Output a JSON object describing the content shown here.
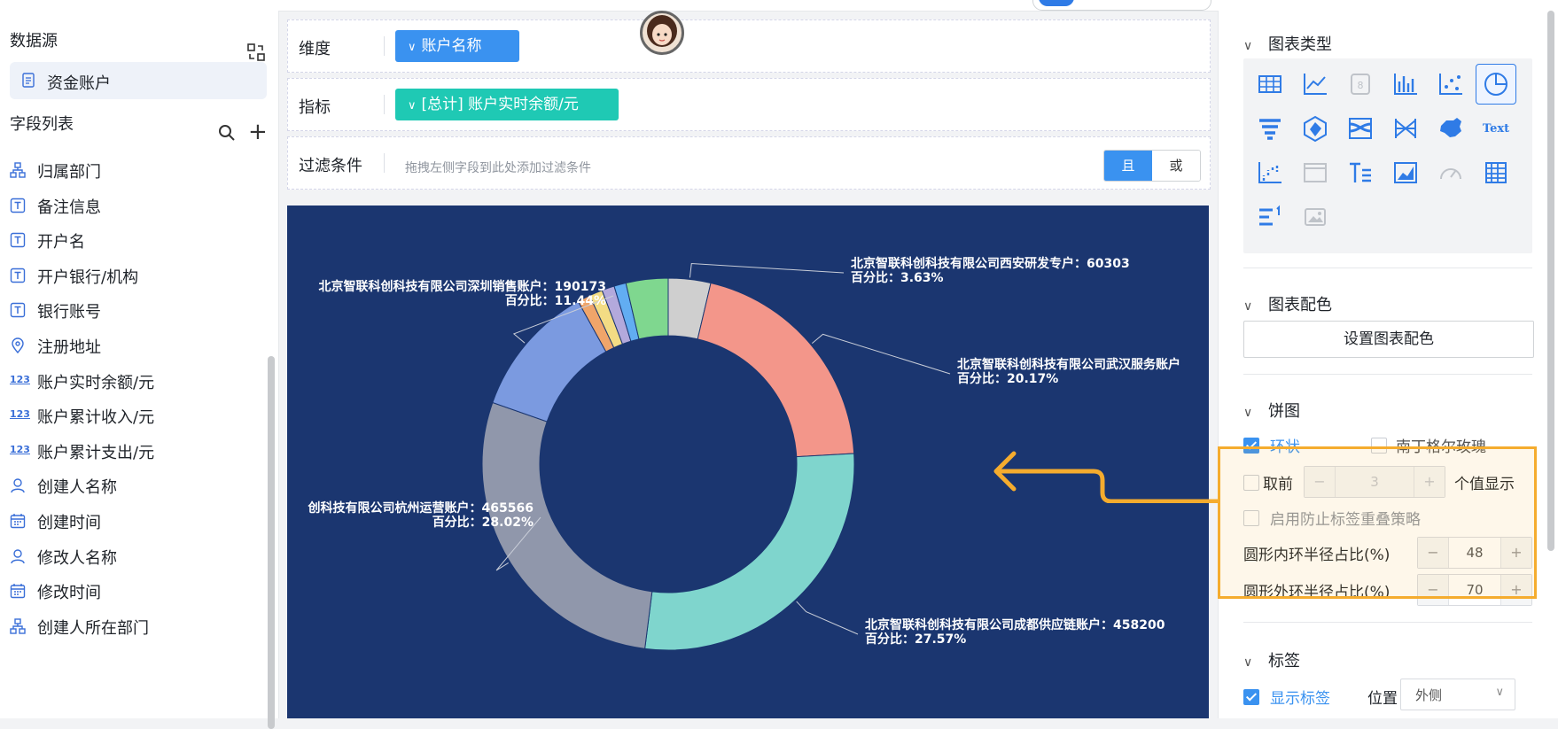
{
  "datasource": {
    "title": "数据源",
    "item": "资金账户"
  },
  "fields": {
    "title": "字段列表",
    "items": [
      {
        "label": "归属部门",
        "icon": "org-icon"
      },
      {
        "label": "备注信息",
        "icon": "text-icon"
      },
      {
        "label": "开户名",
        "icon": "text-icon"
      },
      {
        "label": "开户银行/机构",
        "icon": "text-icon"
      },
      {
        "label": "银行账号",
        "icon": "text-icon"
      },
      {
        "label": "注册地址",
        "icon": "location-icon"
      },
      {
        "label": "账户实时余额/元",
        "icon": "number-icon"
      },
      {
        "label": "账户累计收入/元",
        "icon": "number-icon"
      },
      {
        "label": "账户累计支出/元",
        "icon": "number-icon"
      },
      {
        "label": "创建人名称",
        "icon": "user-icon"
      },
      {
        "label": "创建时间",
        "icon": "calendar-icon"
      },
      {
        "label": "修改人名称",
        "icon": "user-icon"
      },
      {
        "label": "修改时间",
        "icon": "calendar-icon"
      },
      {
        "label": "创建人所在部门",
        "icon": "org-icon"
      }
    ],
    "number_icon_text": "123"
  },
  "query": {
    "dimension_label": "维度",
    "dimension_value": "账户名称",
    "metric_label": "指标",
    "metric_value": "[总计] 账户实时余额/元",
    "filter_label": "过滤条件",
    "filter_hint": "拖拽左侧字段到此处添加过滤条件",
    "and_label": "且",
    "or_label": "或"
  },
  "colors": {
    "chart_bg": "#1b3670",
    "primary": "#3a92f0",
    "metric_pill": "#1fc9b4",
    "highlight": "#f5ac2e"
  },
  "chart_data": {
    "type": "pie",
    "donut": true,
    "inner_radius_pct": 48,
    "outer_radius_pct": 70,
    "slices": [
      {
        "name": "北京智联科创科技有限公司西安研发专户",
        "value": 60303,
        "percent": "3.63%",
        "color": "#cfcfcf"
      },
      {
        "name": "北京智联科创科技有限公司武汉服务账户",
        "value": 335000,
        "percent": "20.17%",
        "color": "#f3968a"
      },
      {
        "name": "北京智联科创科技有限公司成都供应链账户",
        "value": 458200,
        "percent": "27.57%",
        "color": "#7fd5cd"
      },
      {
        "name": "北京智联科创科技有限公司杭州运营账户",
        "value": 465566,
        "percent": "28.02%",
        "color": "#9097ab"
      },
      {
        "name": "北京智联科创科技有限公司深圳销售账户",
        "value": 190173,
        "percent": "11.44%",
        "color": "#7b9ae0"
      },
      {
        "name": "",
        "value": 18000,
        "color": "#f0a56a"
      },
      {
        "name": "",
        "value": 19000,
        "color": "#f3dc84"
      },
      {
        "name": "",
        "value": 18000,
        "color": "#b3a9dc"
      },
      {
        "name": "",
        "value": 17000,
        "color": "#62adf2"
      },
      {
        "name": "",
        "value": 60000,
        "color": "#7fd78f"
      }
    ],
    "labels": [
      {
        "line1": "北京智联科创科技有限公司西安研发专户：60303",
        "line2": "百分比：3.63%"
      },
      {
        "line1": "北京智联科创科技有限公司武汉服务账户",
        "line2": "百分比：20.17%"
      },
      {
        "line1": "北京智联科创科技有限公司成都供应链账户：458200",
        "line2": "百分比：27.57%"
      },
      {
        "line1": "创科技有限公司杭州运营账户：465566",
        "line2": "百分比：28.02%"
      },
      {
        "line1": "北京智联科创科技有限公司深圳销售账户：190173",
        "line2": "百分比：11.44%"
      }
    ]
  },
  "settings": {
    "chart_type_title": "图表类型",
    "chart_color_title": "图表配色",
    "set_color_button": "设置图表配色",
    "pie_title": "饼图",
    "ring_label": "环状",
    "rose_label": "南丁格尔玫瑰",
    "top_label": "取前",
    "top_value": "3",
    "top_suffix": "个值显示",
    "anti_overlap_label": "启用防止标签重叠策略",
    "inner_radius_label": "圆形内环半径占比(%)",
    "inner_radius_value": "48",
    "outer_radius_label": "圆形外环半径占比(%)",
    "outer_radius_value": "70",
    "tag_title": "标签",
    "show_label": "显示标签",
    "position_label": "位置",
    "position_value": "外侧",
    "minus": "−",
    "plus": "+",
    "chart_type_icons": [
      "table-icon",
      "line-chart-icon",
      "indicator-icon",
      "bar-chart-icon",
      "scatter-icon",
      "pie-chart-icon",
      "funnel-icon",
      "radar-icon",
      "sankey-icon",
      "relation-icon",
      "china-map-icon",
      "word-cloud-icon",
      "waterfall-icon",
      "html-icon",
      "rich-text-icon",
      "area-icon",
      "gauge-icon",
      "pivot-table-icon",
      "ranking-icon",
      "image-icon"
    ],
    "word_cloud_text": "Text",
    "html_text": "</>"
  }
}
